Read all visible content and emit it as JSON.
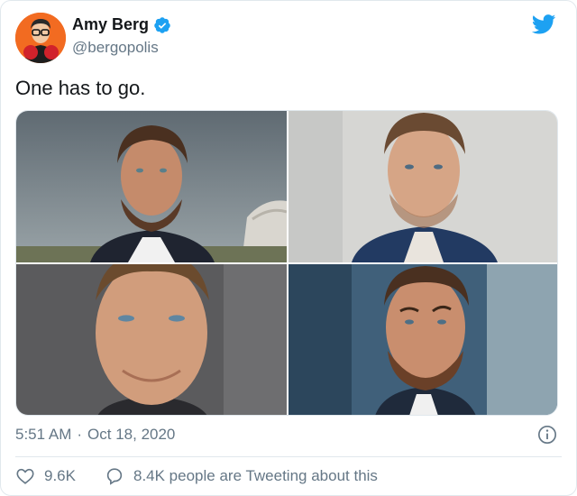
{
  "author": {
    "display_name": "Amy Berg",
    "handle": "@bergopolis",
    "verified": true,
    "avatar_icon": "boxing-avatar"
  },
  "tweet": {
    "text": "One has to go."
  },
  "media": {
    "count": 4,
    "photos": [
      {
        "subject": "man-with-beard-outdoor-photo"
      },
      {
        "subject": "man-with-stubble-portrait-photo"
      },
      {
        "subject": "man-close-up-photo"
      },
      {
        "subject": "man-with-beard-raised-brow-photo"
      }
    ]
  },
  "meta": {
    "time": "5:51 AM",
    "separator": "·",
    "date": "Oct 18, 2020"
  },
  "actions": {
    "likes": "9.6K",
    "tweeting": "8.4K people are Tweeting about this"
  },
  "colors": {
    "twitter_blue": "#1da1f2",
    "secondary_text": "#657786",
    "primary_text": "#14171a",
    "border": "#e1e8ed"
  }
}
